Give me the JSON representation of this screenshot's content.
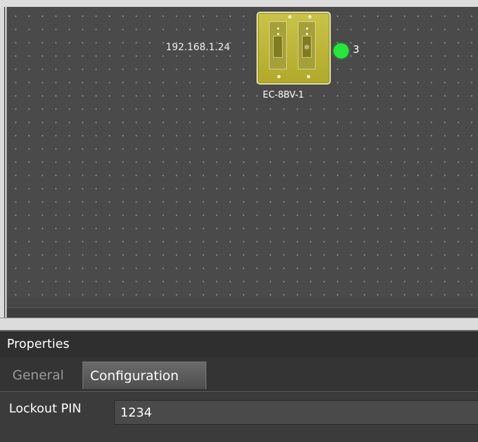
{
  "canvas": {
    "device": {
      "ip": "192.168.1.24",
      "name": "EC-8BV-1",
      "status_count": "3",
      "status_color": "#27e63c",
      "body_color": "#c9c34a",
      "icon": "wallplate-icon"
    }
  },
  "properties": {
    "title": "Properties",
    "tabs": [
      {
        "label": "General",
        "active": false
      },
      {
        "label": "Configuration",
        "active": true
      }
    ],
    "fields": [
      {
        "label": "Lockout PIN",
        "value": "1234"
      }
    ]
  }
}
